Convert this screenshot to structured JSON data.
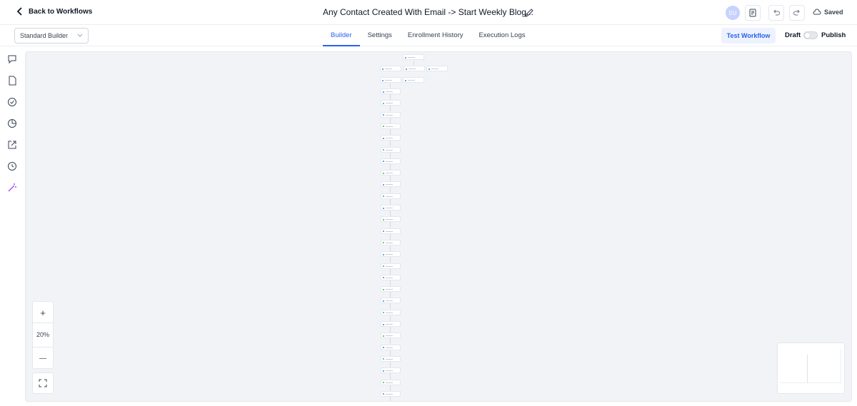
{
  "header": {
    "back_label": "Back to Workflows",
    "workflow_title": "Any Contact Created With Email -> Start Weekly Blog...",
    "avatar_initials": "EU",
    "save_status": "Saved"
  },
  "subheader": {
    "builder_mode": "Standard Builder",
    "tabs": [
      {
        "label": "Builder",
        "active": true
      },
      {
        "label": "Settings",
        "active": false
      },
      {
        "label": "Enrollment History",
        "active": false
      },
      {
        "label": "Execution Logs",
        "active": false
      }
    ],
    "test_button": "Test Workflow",
    "draft_label": "Draft",
    "publish_label": "Publish",
    "published": false
  },
  "sidebar": {
    "icons": [
      "chat-icon",
      "document-icon",
      "check-circle-icon",
      "pie-chart-icon",
      "external-link-icon",
      "history-icon",
      "magic-wand-icon"
    ]
  },
  "canvas": {
    "zoom_level": "20%",
    "zoom_in": "+",
    "zoom_out": "—"
  },
  "colors": {
    "accent": "#2563eb",
    "canvas_bg": "#f1f3f6",
    "magic_icon": "#a855f7",
    "node_green": "#22c55e",
    "node_blue": "#3b82f6"
  }
}
